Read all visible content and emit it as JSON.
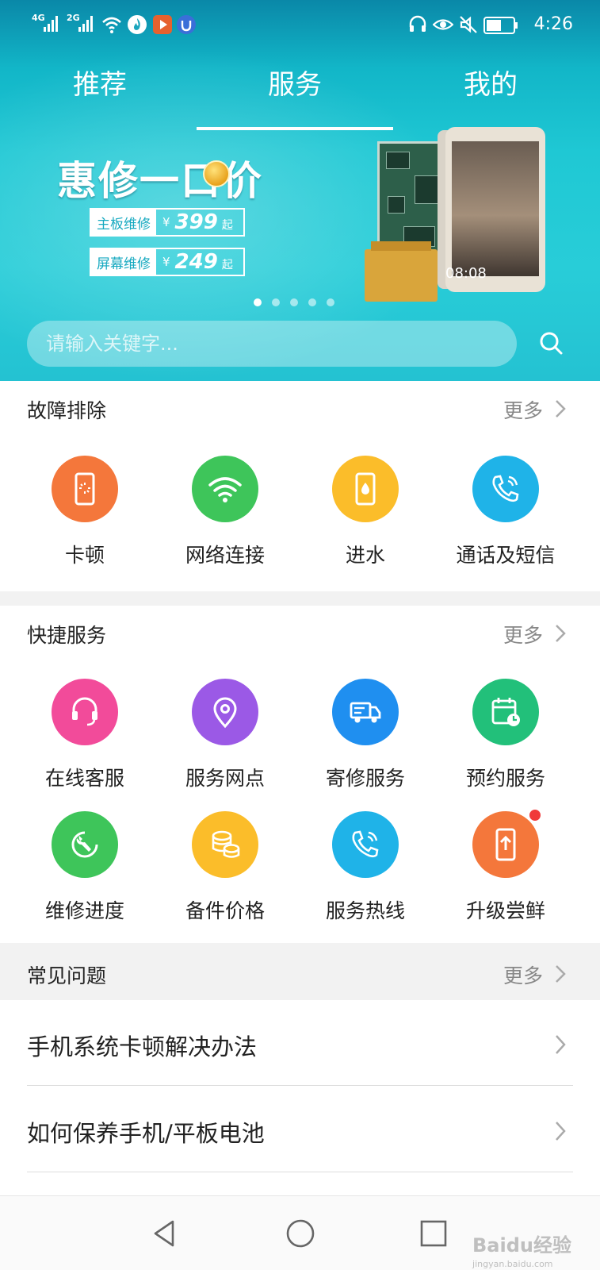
{
  "status_bar": {
    "sim1": "4G",
    "sim2": "2G",
    "time": "4:26",
    "icons": [
      "wifi-icon",
      "flame-app-icon",
      "video-app-icon",
      "shield-app-icon",
      "headset-icon",
      "eye-icon",
      "mute-icon",
      "battery-icon"
    ]
  },
  "tabs": [
    {
      "label": "推荐",
      "active": false
    },
    {
      "label": "服务",
      "active": true
    },
    {
      "label": "我的",
      "active": false
    }
  ],
  "banner": {
    "title": "惠修一口价",
    "offers": [
      {
        "label": "主板维修",
        "currency": "¥",
        "price": "399",
        "suffix": "起"
      },
      {
        "label": "屏幕维修",
        "currency": "¥",
        "price": "249",
        "suffix": "起"
      }
    ],
    "phone_clock": "08:08",
    "carousel_count": 5,
    "carousel_active_index": 0
  },
  "search": {
    "placeholder": "请输入关键字..."
  },
  "troubleshoot": {
    "title": "故障排除",
    "more": "更多",
    "items": [
      {
        "label": "卡顿",
        "icon": "phone-loading-icon",
        "color": "#f4773b"
      },
      {
        "label": "网络连接",
        "icon": "wifi-icon",
        "color": "#3ec55a"
      },
      {
        "label": "进水",
        "icon": "phone-water-icon",
        "color": "#fbbd2a"
      },
      {
        "label": "通话及短信",
        "icon": "phone-call-icon",
        "color": "#1fb3e8"
      }
    ]
  },
  "quick_services": {
    "title": "快捷服务",
    "more": "更多",
    "items": [
      {
        "label": "在线客服",
        "icon": "headset-icon",
        "color": "#f24b9a"
      },
      {
        "label": "服务网点",
        "icon": "location-pin-icon",
        "color": "#9b59e6"
      },
      {
        "label": "寄修服务",
        "icon": "delivery-truck-icon",
        "color": "#1f8ff0"
      },
      {
        "label": "预约服务",
        "icon": "calendar-clock-icon",
        "color": "#22c07a"
      },
      {
        "label": "维修进度",
        "icon": "wrench-icon",
        "color": "#3ec55a"
      },
      {
        "label": "备件价格",
        "icon": "coins-icon",
        "color": "#fbbd2a"
      },
      {
        "label": "服务热线",
        "icon": "phone-call-icon",
        "color": "#1fb3e8"
      },
      {
        "label": "升级尝鲜",
        "icon": "phone-upgrade-icon",
        "color": "#f4773b",
        "badge": true
      }
    ]
  },
  "faq": {
    "title": "常见问题",
    "more": "更多",
    "items": [
      {
        "label": "手机系统卡顿解决办法"
      },
      {
        "label": "如何保养手机/平板电池"
      }
    ]
  },
  "watermark": {
    "brand": "Baidu经验",
    "url": "jingyan.baidu.com"
  }
}
